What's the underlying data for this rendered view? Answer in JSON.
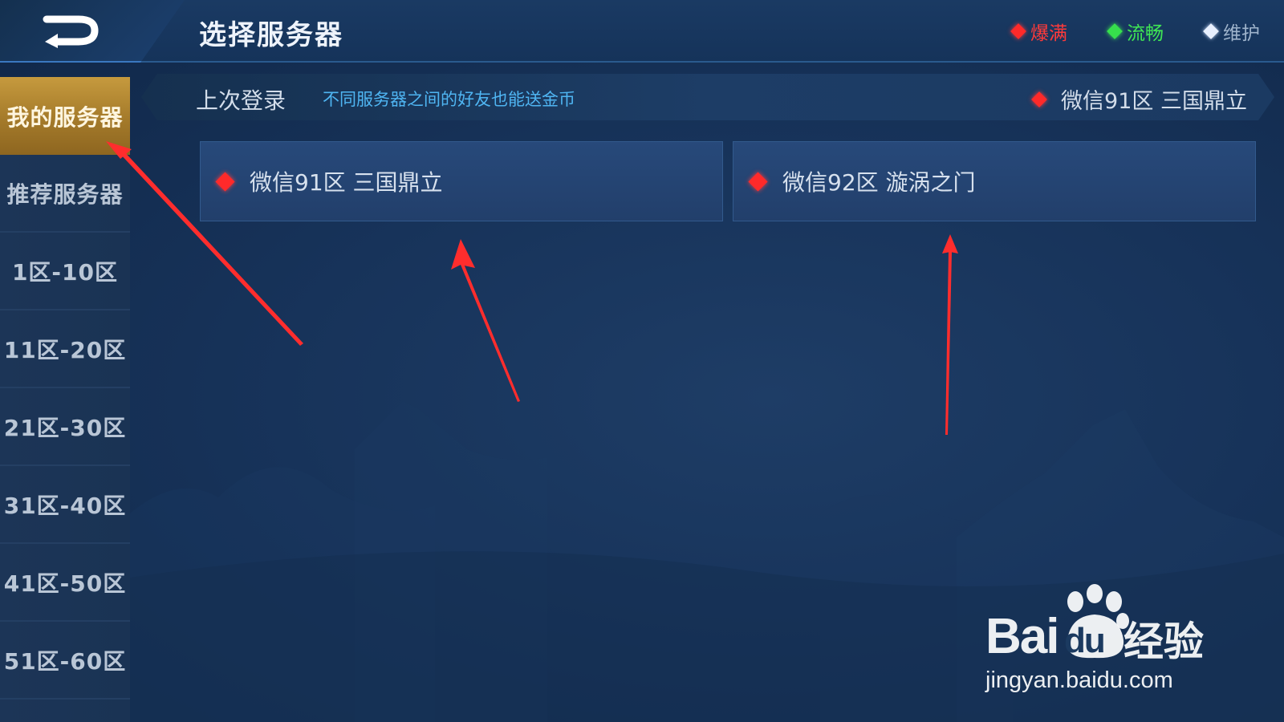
{
  "header": {
    "title": "选择服务器",
    "legend": [
      {
        "label": "爆满",
        "color": "#ff3a3a"
      },
      {
        "label": "流畅",
        "color": "#3fe654"
      },
      {
        "label": "维护",
        "color": "#9fb4cc"
      }
    ]
  },
  "sidebar": {
    "items": [
      {
        "label": "我的服务器",
        "active": true
      },
      {
        "label": "推荐服务器",
        "active": false
      },
      {
        "label": "1区-10区",
        "active": false
      },
      {
        "label": "11区-20区",
        "active": false
      },
      {
        "label": "21区-30区",
        "active": false
      },
      {
        "label": "31区-40区",
        "active": false
      },
      {
        "label": "41区-50区",
        "active": false
      },
      {
        "label": "51区-60区",
        "active": false
      }
    ]
  },
  "info_strip": {
    "last_login_label": "上次登录",
    "hint": "不同服务器之间的好友也能送金币",
    "last_server": "微信91区 三国鼎立"
  },
  "servers": [
    {
      "name": "微信91区 三国鼎立",
      "status": "爆满",
      "status_color": "#ff2a2a"
    },
    {
      "name": "微信92区 漩涡之门",
      "status": "爆满",
      "status_color": "#ff2a2a"
    }
  ],
  "watermark": {
    "brand_a": "Bai",
    "brand_b": "du",
    "brand_c": "经验",
    "url": "jingyan.baidu.com"
  }
}
